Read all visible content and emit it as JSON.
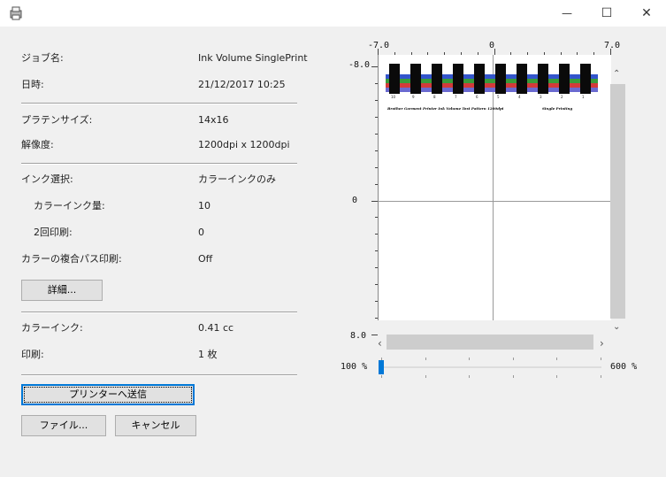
{
  "window": {
    "title": "",
    "icon": "printer-shirt-icon",
    "controls": {
      "minimize": "—",
      "maximize": "☐",
      "close": "✕"
    }
  },
  "info": {
    "job_name_label": "ジョブ名:",
    "job_name_value": "Ink Volume SinglePrint",
    "datetime_label": "日時:",
    "datetime_value": "21/12/2017 10:25",
    "platen_label": "プラテンサイズ:",
    "platen_value": "14x16",
    "resolution_label": "解像度:",
    "resolution_value": "1200dpi x 1200dpi",
    "ink_select_label": "インク選択:",
    "ink_select_value": "カラーインクのみ",
    "color_ink_amount_label": "カラーインク量:",
    "color_ink_amount_value": "10",
    "double_print_label": "2回印刷:",
    "double_print_value": "0",
    "multipass_label": "カラーの複合パス印刷:",
    "multipass_value": "Off",
    "color_ink_label": "カラーインク:",
    "color_ink_value": "0.41 cc",
    "print_count_label": "印刷:",
    "print_count_value": "1 枚"
  },
  "buttons": {
    "details": "詳細...",
    "send_to_printer": "プリンターへ送信",
    "file": "ファイル...",
    "cancel": "キャンセル"
  },
  "preview": {
    "x_axis": {
      "min": "-7.0",
      "mid": "0",
      "max": "7.0"
    },
    "y_axis": {
      "min": "-8.0",
      "mid": "0",
      "max": "8.0"
    },
    "pattern_numbers": [
      "10",
      "9",
      "8",
      "7",
      "6",
      "5",
      "4",
      "3",
      "2",
      "1"
    ],
    "pattern_caption_left": "Brother Garment Printer Ink Volume Test Pattern 1200dpi",
    "pattern_caption_right": "Single Printing",
    "swatch_colors": [
      "#0a0a0a",
      "#d33a3a",
      "#3a9a3a",
      "#3355cc",
      "#6a6ad0"
    ]
  },
  "zoom": {
    "min_label": "100 %",
    "max_label": "600 %",
    "level_percent": 0
  }
}
